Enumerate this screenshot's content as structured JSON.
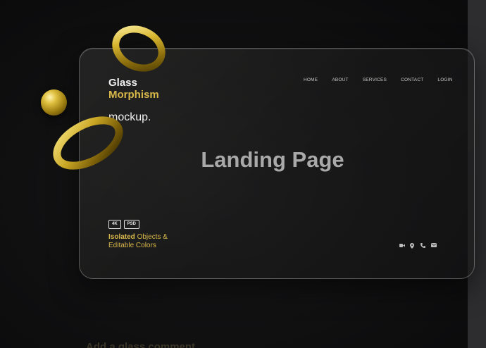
{
  "brand": {
    "line1": "Glass",
    "line2": "Morphism"
  },
  "mockup_label": "mockup.",
  "nav": {
    "items": [
      "HOME",
      "ABOUT",
      "SERVICES",
      "CONTACT",
      "LOGIN"
    ]
  },
  "headline": "Landing Page",
  "badges": [
    "4K",
    "PSD"
  ],
  "caption": {
    "strong": "Isolated",
    "rest1": " Objects &",
    "line2": "Editable Colors"
  },
  "socials": [
    "video-icon",
    "location-pin-icon",
    "phone-icon",
    "mail-icon"
  ],
  "footer_text": "Add a glass comment",
  "colors": {
    "gold": "#d9b84a",
    "background": "#111112",
    "headline": "#a9a9a9"
  }
}
